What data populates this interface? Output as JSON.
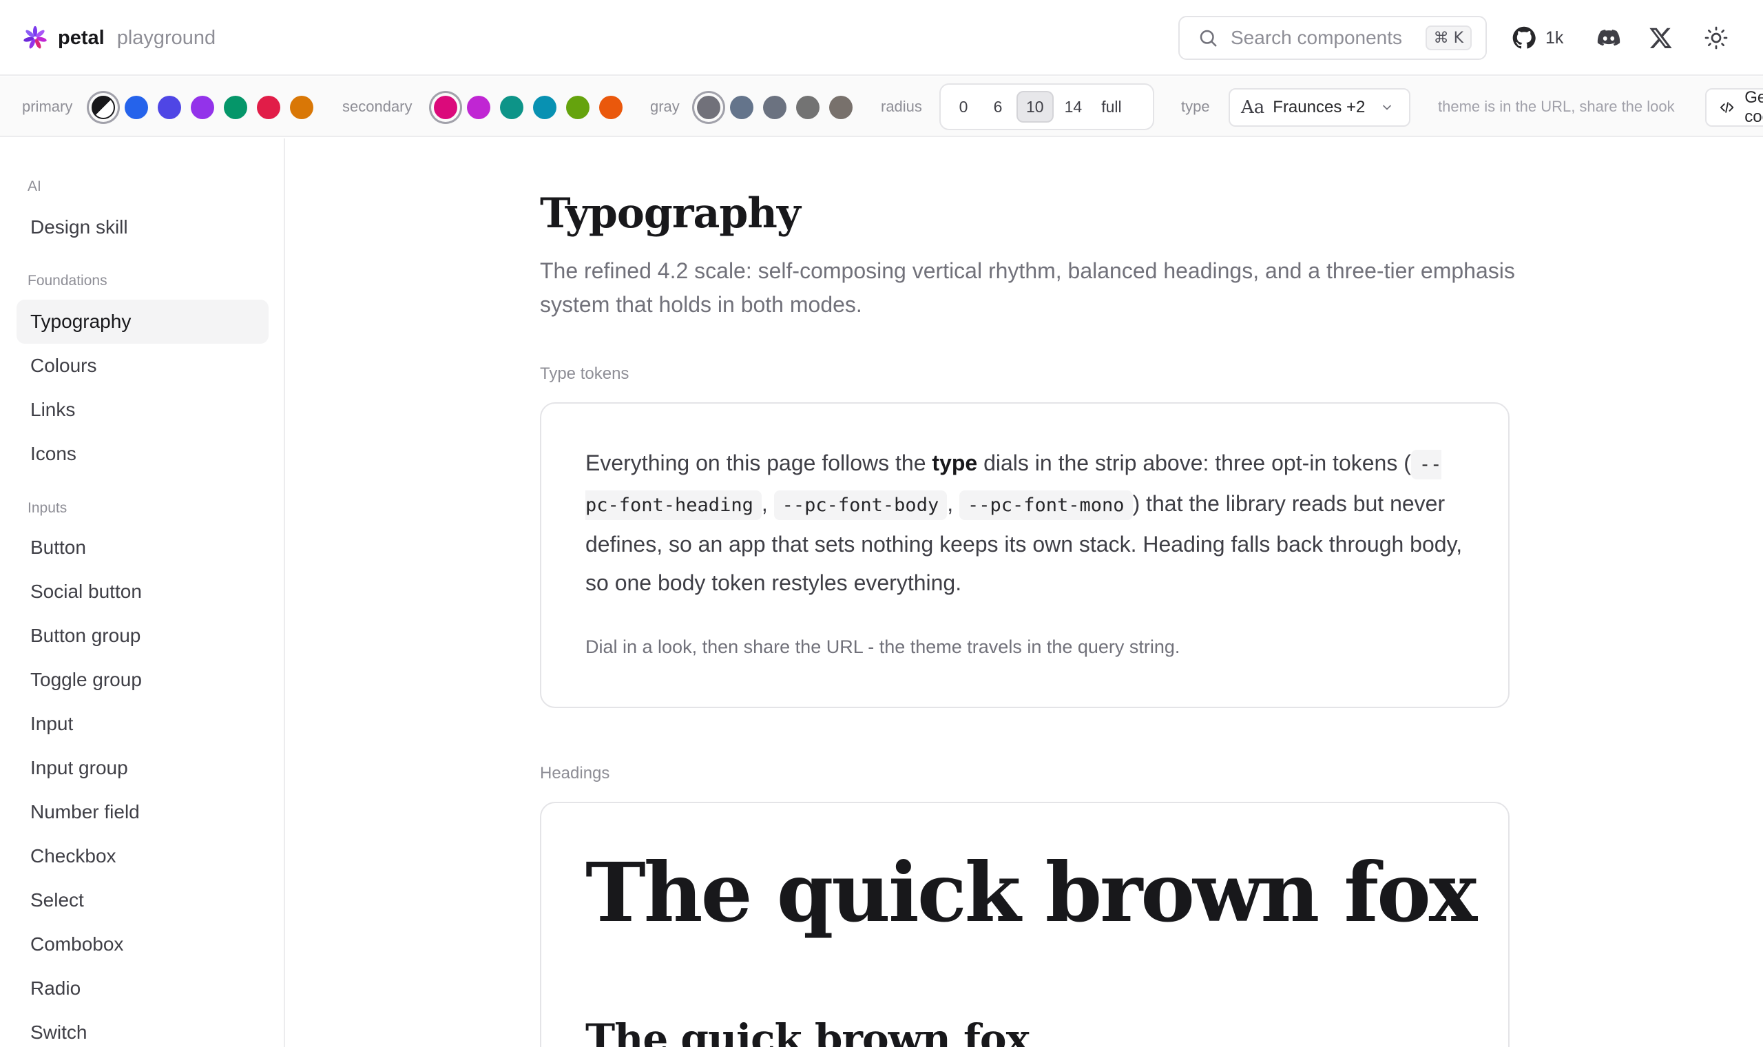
{
  "header": {
    "brand_name": "petal",
    "brand_sub": "playground",
    "search_placeholder": "Search components",
    "search_shortcut": "⌘ K",
    "github_count": "1k",
    "icons": [
      "petal-logo-icon",
      "search-icon",
      "github-icon",
      "discord-icon",
      "x-icon",
      "sun-icon"
    ]
  },
  "strip": {
    "primary_label": "primary",
    "primary_colors": [
      "#18181b",
      "#2563eb",
      "#4f46e5",
      "#9333ea",
      "#059669",
      "#e11d48",
      "#d97706"
    ],
    "secondary_label": "secondary",
    "secondary_colors": [
      "#db0a7b",
      "#c026d3",
      "#0d9488",
      "#0891b2",
      "#65a30d",
      "#ea580c"
    ],
    "gray_label": "gray",
    "gray_colors": [
      "#71717a",
      "#64748b",
      "#6b7280",
      "#737373",
      "#78716c"
    ],
    "radius_label": "radius",
    "radius_options": [
      "0",
      "6",
      "10",
      "14",
      "full"
    ],
    "radius_selected": "10",
    "type_label": "type",
    "type_icon_text": "Aa",
    "type_value": "Fraunces +2",
    "share_note": "theme is in the URL, share the look",
    "code_button": "Get code"
  },
  "sidebar": {
    "groups": [
      {
        "title": "AI",
        "items": [
          "Design skill"
        ]
      },
      {
        "title": "Foundations",
        "items": [
          "Typography",
          "Colours",
          "Links",
          "Icons"
        ]
      },
      {
        "title": "Inputs",
        "items": [
          "Button",
          "Social button",
          "Button group",
          "Toggle group",
          "Input",
          "Input group",
          "Number field",
          "Checkbox",
          "Select",
          "Combobox",
          "Radio",
          "Switch"
        ]
      }
    ],
    "active_item": "Typography"
  },
  "main": {
    "title": "Typography",
    "description": "The refined 4.2 scale: self-composing vertical rhythm, balanced headings, and a three-tier emphasis system that holds in both modes.",
    "type_tokens_label": "Type tokens",
    "tokens_card": {
      "text_1": "Everything on this page follows the ",
      "bold": "type",
      "text_2": " dials in the strip above: three opt-in tokens (",
      "token_heading": "--pc-font-heading",
      "sep_1": ",",
      "token_body": "--pc-font-body",
      "sep_2": ",",
      "token_mono": "--pc-font-mono",
      "text_3": ") that the library reads but never defines, so an app that sets nothing keeps its own stack. Heading falls back through body, so one body token restyles everything.",
      "note": "Dial in a look, then share the URL - the theme travels in the query string."
    },
    "headings_label": "Headings",
    "heading_sample_1": "The quick brown fox",
    "heading_sample_2": "The quick brown fox"
  }
}
